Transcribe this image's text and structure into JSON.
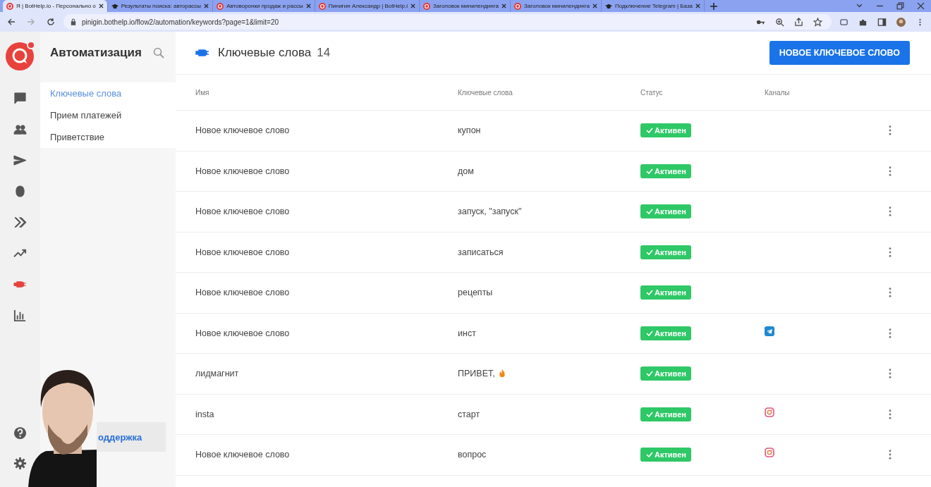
{
  "browser": {
    "tabs": [
      {
        "title": "Я | BotHelp.io - Персонально о",
        "kind": "bothelp",
        "selected": true
      },
      {
        "title": "Результаты поиска: авторассы",
        "kind": "cap",
        "selected": false
      },
      {
        "title": "Автоворонки продаж и рассы",
        "kind": "bothelp",
        "selected": false
      },
      {
        "title": "Пинигин Александр | BotHelp.i",
        "kind": "bothelp",
        "selected": false
      },
      {
        "title": "Заголовок минилендинга",
        "kind": "bothelp",
        "selected": false
      },
      {
        "title": "Заголовок минилендинга",
        "kind": "bothelp",
        "selected": false
      },
      {
        "title": "Подключение Telegram | База",
        "kind": "cap",
        "selected": false
      }
    ],
    "url": "pinigin.bothelp.io/flow2/automation/keywords?page=1&limit=20"
  },
  "rail": {
    "items": [
      {
        "kind": "chat",
        "selected": false
      },
      {
        "kind": "people",
        "selected": false
      },
      {
        "kind": "send",
        "selected": false
      },
      {
        "kind": "bug",
        "selected": false
      },
      {
        "kind": "chevrons",
        "selected": false
      },
      {
        "kind": "trend",
        "selected": false
      },
      {
        "kind": "plug",
        "selected": true
      },
      {
        "kind": "chart",
        "selected": false
      }
    ]
  },
  "sidebar": {
    "title": "Автоматизация",
    "items": [
      {
        "label": "Ключевые слова",
        "selected": true
      },
      {
        "label": "Прием платежей",
        "selected": false
      },
      {
        "label": "Приветствие",
        "selected": false
      }
    ],
    "support": "оддержка"
  },
  "header": {
    "title": "Ключевые слова",
    "count": "14",
    "button": "НОВОЕ КЛЮЧЕВОЕ СЛОВО"
  },
  "table": {
    "columns": [
      "Имя",
      "Ключевые слова",
      "Статус",
      "Каналы"
    ],
    "rows": [
      {
        "name": "Новое ключевое слово",
        "keywords": "купон",
        "status": "Активен",
        "active": true
      },
      {
        "name": "Новое ключевое слово",
        "keywords": "дом",
        "status": "Активен",
        "active": true
      },
      {
        "name": "Новое ключевое слово",
        "keywords": "запуск, \"запуск\"",
        "status": "Активен",
        "active": true
      },
      {
        "name": "Новое ключевое слово",
        "keywords": "записаться",
        "status": "Активен",
        "active": true
      },
      {
        "name": "Новое ключевое слово",
        "keywords": "рецепты",
        "status": "Активен",
        "active": true
      },
      {
        "name": "Новое ключевое слово",
        "keywords": "инст",
        "status": "Активен",
        "active": true,
        "channel": {
          "kind": "telegram"
        }
      },
      {
        "name": "лидмагнит",
        "keywords": "ПРИВЕТ,",
        "fire": true,
        "status": "Активен",
        "active": true
      },
      {
        "name": "insta",
        "keywords": "старт",
        "status": "Активен",
        "active": true,
        "channel": {
          "kind": "instagram"
        }
      },
      {
        "name": "Новое ключевое слово",
        "keywords": "вопрос",
        "status": "Активен",
        "active": true,
        "channel": {
          "kind": "instagram"
        }
      }
    ]
  }
}
